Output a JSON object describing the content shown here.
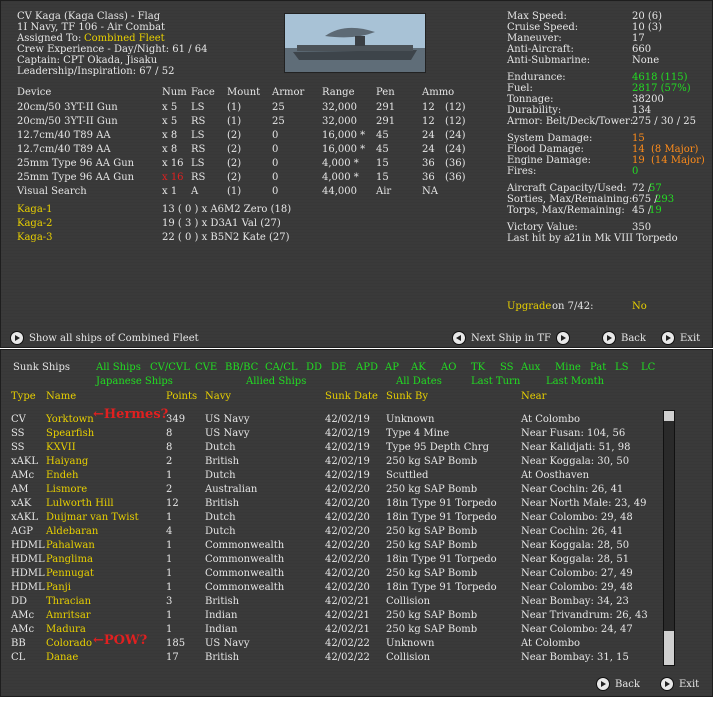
{
  "ship": {
    "title": "CV Kaga (Kaga Class) - Flag",
    "line2": "1I Navy, TF 106 - Air Combat",
    "assigned_label": "Assigned To:",
    "assigned_value": "Combined Fleet",
    "crew": "Crew Experience - Day/Night: 61 / 64",
    "captain": "Captain: CPT Okada, Jisaku",
    "leadership": "Leadership/Inspiration: 67 / 52"
  },
  "stats": [
    {
      "label": "Max Speed:",
      "value": "20 (6)"
    },
    {
      "label": "Cruise Speed:",
      "value": "10 (3)"
    },
    {
      "label": "Maneuver:",
      "value": "17"
    },
    {
      "label": "Anti-Aircraft:",
      "value": "660"
    },
    {
      "label": "Anti-Submarine:",
      "value": "None"
    }
  ],
  "stats2": [
    {
      "label": "Endurance:",
      "value": "4618 (115)"
    },
    {
      "label": "Fuel:",
      "value": "2817 (57%)"
    },
    {
      "label": "Tonnage:",
      "value": "38200"
    },
    {
      "label": "Durability:",
      "value": "134"
    },
    {
      "label": "Armor: Belt/Deck/Tower:",
      "value": "275 / 30 / 25"
    }
  ],
  "damage": {
    "system_label": "System Damage:",
    "system_value": "15",
    "flood_label": "Flood Damage:",
    "flood_value": "14",
    "flood_major": "(8 Major)",
    "engine_label": "Engine Damage:",
    "engine_value": "19",
    "engine_major": "(14 Major)",
    "fires_label": "Fires:",
    "fires_value": "0"
  },
  "aircraft": {
    "cap_label": "Aircraft Capacity/Used:",
    "cap_a": "72 /",
    "cap_b": "57",
    "sorties_label": "Sorties, Max/Remaining:",
    "sorties_a": "675 /",
    "sorties_b": "293",
    "torps_label": "Torps, Max/Remaining:",
    "torps_a": "45 /",
    "torps_b": "19",
    "victory_label": "Victory Value:",
    "victory_value": "350",
    "lasthit_label": "Last hit by a",
    "lasthit_value": "21in Mk VIII Torpedo"
  },
  "upgrade": {
    "label": "Upgrade",
    "on": "on 7/42:",
    "value": "No"
  },
  "weapon_headers": [
    "Device",
    "Num",
    "Face",
    "Mount",
    "Armor",
    "Range",
    "Pen",
    "Ammo"
  ],
  "weapons": [
    {
      "device": "20cm/50 3YT-II Gun",
      "num": "x 5",
      "face": "LS",
      "mount": "(1)",
      "armor": "25",
      "range": "32,000",
      "pen": "291",
      "ammo": "12",
      "ammo2": "(12)"
    },
    {
      "device": "20cm/50 3YT-II Gun",
      "num": "x 5",
      "face": "RS",
      "mount": "(1)",
      "armor": "25",
      "range": "32,000",
      "pen": "291",
      "ammo": "12",
      "ammo2": "(12)"
    },
    {
      "device": "12.7cm/40 T89 AA",
      "num": "x 8",
      "face": "LS",
      "mount": "(2)",
      "armor": "0",
      "range": "16,000 *",
      "pen": "45",
      "ammo": "24",
      "ammo2": "(24)"
    },
    {
      "device": "12.7cm/40 T89 AA",
      "num": "x 8",
      "face": "RS",
      "mount": "(2)",
      "armor": "0",
      "range": "16,000 *",
      "pen": "45",
      "ammo": "24",
      "ammo2": "(24)"
    },
    {
      "device": "25mm Type 96 AA Gun",
      "num": "x 16",
      "face": "LS",
      "mount": "(2)",
      "armor": "0",
      "range": "4,000 *",
      "pen": "15",
      "ammo": "36",
      "ammo2": "(36)"
    },
    {
      "device": "25mm Type 96 AA Gun",
      "num": "x 16",
      "face": "RS",
      "mount": "(2)",
      "armor": "0",
      "range": "4,000 *",
      "pen": "15",
      "ammo": "36",
      "ammo2": "(36)"
    },
    {
      "device": "Visual Search",
      "num": "x 1",
      "face": "A",
      "mount": "(1)",
      "armor": "0",
      "range": "44,000",
      "pen": "Air",
      "ammo": "NA",
      "ammo2": ""
    }
  ],
  "airgroups": [
    {
      "name": "Kaga-1",
      "info": "13 ( 0 ) x A6M2 Zero (18)"
    },
    {
      "name": "Kaga-2",
      "info": "19 ( 3 ) x D3A1 Val (27)"
    },
    {
      "name": "Kaga-3",
      "info": "22 ( 0 ) x B5N2 Kate (27)"
    }
  ],
  "top_buttons": {
    "show_all": "Show all ships of Combined Fleet",
    "next": "Next Ship in TF",
    "back": "Back",
    "exit": "Exit"
  },
  "sunk": {
    "title": "Sunk Ships",
    "filters1": [
      "All Ships",
      "CV/CVL",
      "CVE",
      "BB/BC",
      "CA/CL",
      "DD",
      "DE",
      "APD",
      "AP",
      "AK",
      "AO",
      "TK",
      "SS",
      "Aux",
      "Mine",
      "Pat",
      "LS",
      "LC"
    ],
    "filters2": [
      "Japanese Ships",
      "Allied Ships",
      "All Dates",
      "Last Turn",
      "Last Month"
    ],
    "headers": [
      "Type",
      "Name",
      "Points",
      "Navy",
      "Sunk Date",
      "Sunk By",
      "Near"
    ],
    "rows": [
      [
        "CV",
        "Yorktown",
        "349",
        "US Navy",
        "42/02/19",
        "Unknown",
        "At Colombo"
      ],
      [
        "SS",
        "Spearfish",
        "8",
        "US Navy",
        "42/02/19",
        "Type 4 Mine",
        "Near Fusan: 104, 56"
      ],
      [
        "SS",
        "KXVII",
        "8",
        "Dutch",
        "42/02/19",
        "Type 95 Depth Chrg",
        "Near Kalidjati: 51, 98"
      ],
      [
        "xAKL",
        "Haiyang",
        "2",
        "British",
        "42/02/19",
        "250 kg SAP Bomb",
        "Near Koggala: 30, 50"
      ],
      [
        "AMc",
        "Endeh",
        "1",
        "Dutch",
        "42/02/19",
        "Scuttled",
        "At Oosthaven"
      ],
      [
        "AM",
        "Lismore",
        "2",
        "Australian",
        "42/02/20",
        "250 kg SAP Bomb",
        "Near Cochin: 26, 41"
      ],
      [
        "xAK",
        "Lulworth Hill",
        "12",
        "British",
        "42/02/20",
        "18in Type 91 Torpedo",
        "Near North Male: 23, 49"
      ],
      [
        "xAKL",
        "Duijmar van Twist",
        "1",
        "Dutch",
        "42/02/20",
        "18in Type 91 Torpedo",
        "Near Colombo: 29, 48"
      ],
      [
        "AGP",
        "Aldebaran",
        "4",
        "Dutch",
        "42/02/20",
        "250 kg SAP Bomb",
        "Near Cochin: 26, 41"
      ],
      [
        "HDML",
        "Pahalwan",
        "1",
        "Commonwealth",
        "42/02/20",
        "250 kg SAP Bomb",
        "Near Koggala: 28, 50"
      ],
      [
        "HDML",
        "Panglima",
        "1",
        "Commonwealth",
        "42/02/20",
        "18in Type 91 Torpedo",
        "Near Koggala: 28, 51"
      ],
      [
        "HDML",
        "Pennugat",
        "1",
        "Commonwealth",
        "42/02/20",
        "250 kg SAP Bomb",
        "Near Colombo: 27, 49"
      ],
      [
        "HDML",
        "Panji",
        "1",
        "Commonwealth",
        "42/02/20",
        "18in Type 91 Torpedo",
        "Near Colombo: 29, 48"
      ],
      [
        "DD",
        "Thracian",
        "3",
        "British",
        "42/02/21",
        "Collision",
        "Near Bombay: 34, 23"
      ],
      [
        "AMc",
        "Amritsar",
        "1",
        "Indian",
        "42/02/21",
        "250 kg SAP Bomb",
        "Near Trivandrum: 26, 43"
      ],
      [
        "AMc",
        "Madura",
        "1",
        "Indian",
        "42/02/21",
        "250 kg SAP Bomb",
        "Near Colombo: 24, 47"
      ],
      [
        "BB",
        "Colorado",
        "185",
        "US Navy",
        "42/02/22",
        "Unknown",
        "At Colombo"
      ],
      [
        "CL",
        "Danae",
        "17",
        "British",
        "42/02/22",
        "Collision",
        "Near Bombay: 31, 15"
      ]
    ],
    "annotations": [
      "←Hermes?",
      "←POW?"
    ],
    "back": "Back",
    "exit": "Exit"
  }
}
